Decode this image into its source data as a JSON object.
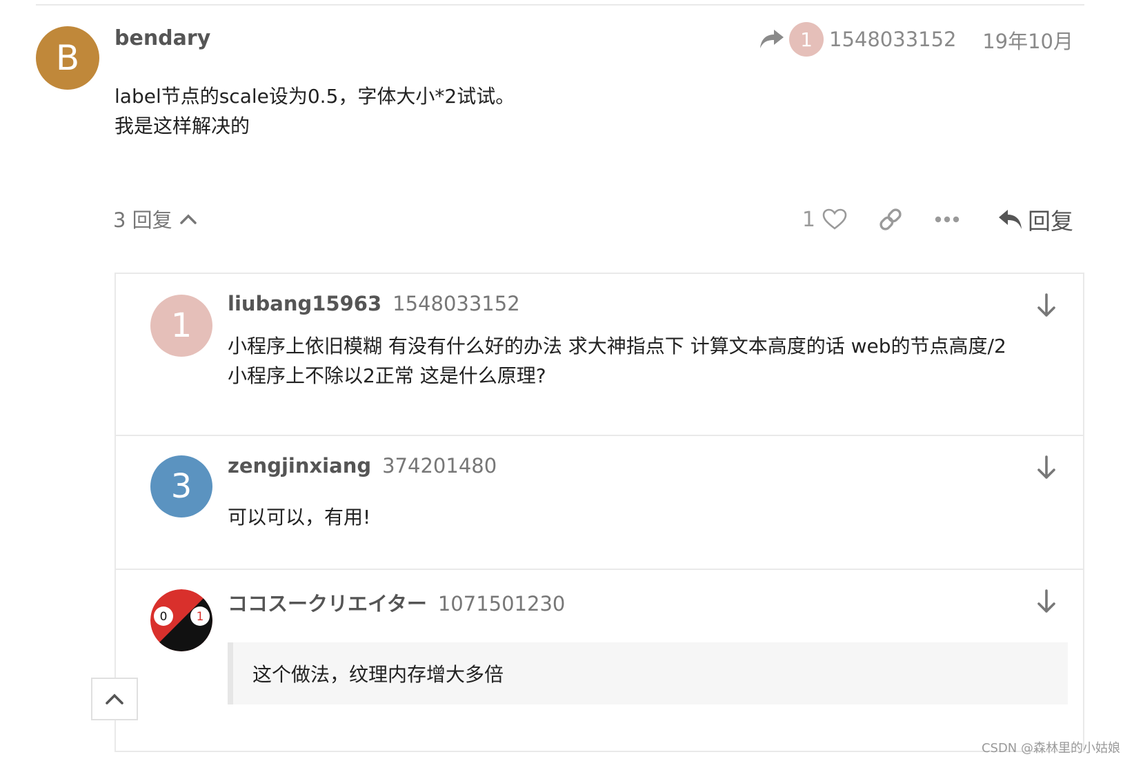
{
  "post": {
    "avatar_letter": "B",
    "avatar_color": "#c0883a",
    "username": "bendary",
    "reply_to": {
      "avatar_text": "1",
      "avatar_color": "#e5bfb9",
      "name": "1548033152"
    },
    "date": "19年10月",
    "body_lines": [
      "label节点的scale设为0.5，字体大小*2试试。",
      "我是这样解决的"
    ],
    "replies_toggle": "3 回复",
    "like_count": "1",
    "reply_button_label": "回复"
  },
  "replies": [
    {
      "avatar_text": "1",
      "avatar_color": "#e5bfb9",
      "username": "liubang15963",
      "user_id": "1548033152",
      "body_lines": [
        "小程序上依旧模糊 有没有什么好的办法 求大神指点下 计算文本高度的话 web的节点高度/2",
        "小程序上不除以2正常 这是什么原理?"
      ]
    },
    {
      "avatar_text": "3",
      "avatar_color": "#5b93c0",
      "username": "zengjinxiang",
      "user_id": "374201480",
      "body_lines": [
        "可以可以，有用!"
      ]
    },
    {
      "avatar_badges": [
        "0",
        "1"
      ],
      "avatar_colors": {
        "red": "#d9302c",
        "black": "#111111"
      },
      "username": "ココスークリエイター",
      "user_id": "1071501230",
      "quote": "这个做法，纹理内存增大多倍"
    }
  ],
  "watermark": "CSDN @森林里的小姑娘"
}
